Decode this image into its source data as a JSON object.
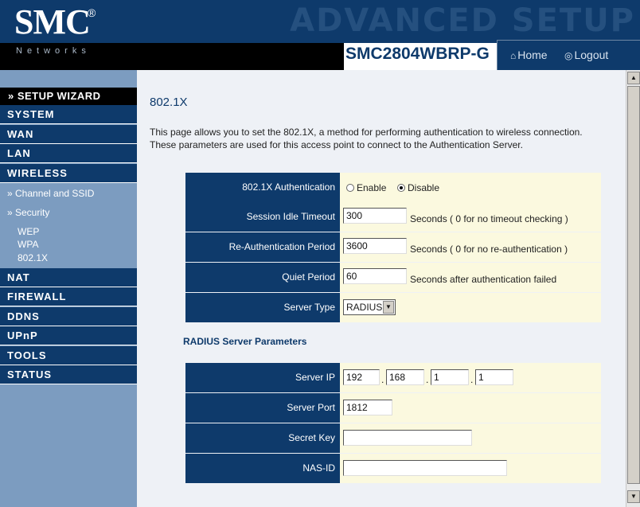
{
  "header": {
    "logo_text": "SMC",
    "logo_reg": "®",
    "logo_sub": "Networks",
    "banner": "ADVANCED SETUP",
    "model": "SMC2804WBRP-G",
    "home_label": "Home",
    "logout_label": "Logout"
  },
  "sidebar": {
    "wizard_label": "» SETUP WIZARD",
    "menus": [
      "SYSTEM",
      "WAN",
      "LAN",
      "WIRELESS",
      "NAT",
      "FIREWALL",
      "DDNS",
      "UPnP",
      "TOOLS",
      "STATUS"
    ],
    "wireless_sub": [
      "» Channel and SSID",
      "» Security"
    ],
    "security_sub": [
      "WEP",
      "WPA",
      "802.1X"
    ]
  },
  "main": {
    "title": "802.1X",
    "description": "This page allows you to set the 802.1X, a method for performing authentication to wireless connection.  These parameters are used for this access point to connect to the Authentication Server.",
    "auth": {
      "label": "802.1X Authentication",
      "enable_label": "Enable",
      "disable_label": "Disable",
      "selected": "Disable"
    },
    "session_idle": {
      "label": "Session Idle Timeout",
      "value": "300",
      "note": "Seconds ( 0 for no timeout checking )"
    },
    "reauth": {
      "label": "Re-Authentication Period",
      "value": "3600",
      "note": "Seconds ( 0 for no re-authentication )"
    },
    "quiet": {
      "label": "Quiet Period",
      "value": "60",
      "note": "Seconds after authentication failed"
    },
    "server_type": {
      "label": "Server Type",
      "value": "RADIUS"
    },
    "radius_heading": "RADIUS Server Parameters",
    "server_ip": {
      "label": "Server IP",
      "octets": [
        "192",
        "168",
        "1",
        "1"
      ]
    },
    "server_port": {
      "label": "Server Port",
      "value": "1812"
    },
    "secret_key": {
      "label": "Secret Key",
      "value": ""
    },
    "nas_id": {
      "label": "NAS-ID",
      "value": ""
    }
  },
  "colors": {
    "nav_dark": "#0e3a6b",
    "sidebar_bg": "#7c9cc0",
    "value_bg": "#fbf9df",
    "content_bg": "#eef1f6"
  }
}
